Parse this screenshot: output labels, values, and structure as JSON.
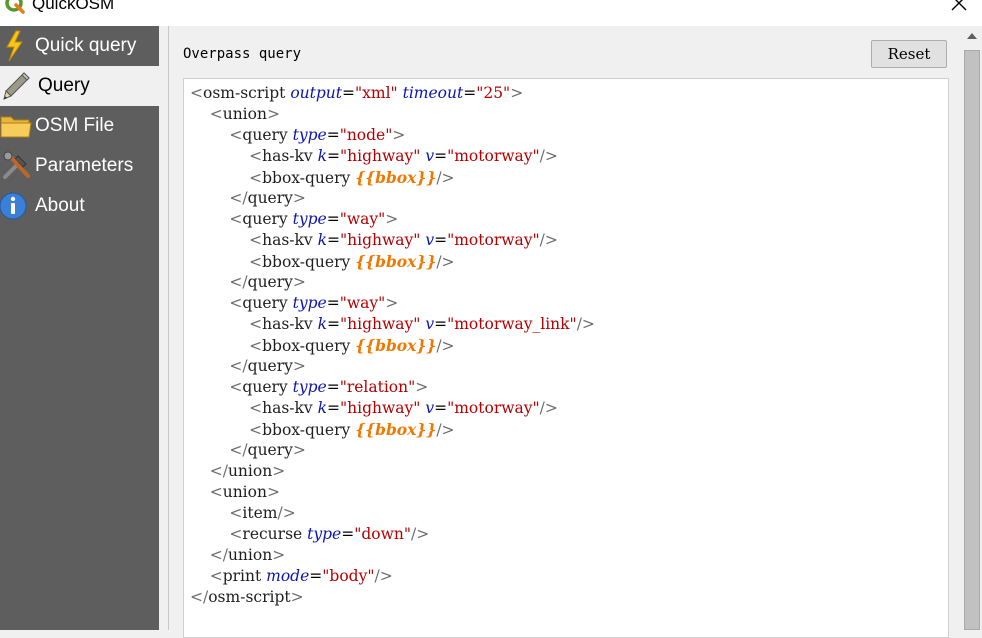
{
  "window": {
    "title": "QuickOSM"
  },
  "sidebar": {
    "items": [
      {
        "label": "Quick query",
        "icon": "lightning-icon",
        "active": false
      },
      {
        "label": "Query",
        "icon": "pencil-icon",
        "active": true
      },
      {
        "label": "OSM File",
        "icon": "folder-icon",
        "active": false
      },
      {
        "label": "Parameters",
        "icon": "tools-icon",
        "active": false
      },
      {
        "label": "About",
        "icon": "info-icon",
        "active": false
      }
    ]
  },
  "main": {
    "section_label": "Overpass query",
    "reset_label": "Reset",
    "query_lines": [
      [
        {
          "t": "br",
          "v": "<"
        },
        {
          "t": "tag",
          "v": "osm-script "
        },
        {
          "t": "attr",
          "v": "output"
        },
        {
          "t": "eq",
          "v": "="
        },
        {
          "t": "val",
          "v": "\"xml\""
        },
        {
          "t": "tag",
          "v": " "
        },
        {
          "t": "attr",
          "v": "timeout"
        },
        {
          "t": "eq",
          "v": "="
        },
        {
          "t": "val",
          "v": "\"25\""
        },
        {
          "t": "br",
          "v": ">"
        }
      ],
      [
        {
          "t": "tag",
          "v": "    "
        },
        {
          "t": "br",
          "v": "<"
        },
        {
          "t": "tag",
          "v": "union"
        },
        {
          "t": "br",
          "v": ">"
        }
      ],
      [
        {
          "t": "tag",
          "v": "        "
        },
        {
          "t": "br",
          "v": "<"
        },
        {
          "t": "tag",
          "v": "query "
        },
        {
          "t": "attr",
          "v": "type"
        },
        {
          "t": "eq",
          "v": "="
        },
        {
          "t": "val",
          "v": "\"node\""
        },
        {
          "t": "br",
          "v": ">"
        }
      ],
      [
        {
          "t": "tag",
          "v": "            "
        },
        {
          "t": "br",
          "v": "<"
        },
        {
          "t": "tag",
          "v": "has-kv "
        },
        {
          "t": "attr",
          "v": "k"
        },
        {
          "t": "eq",
          "v": "="
        },
        {
          "t": "val",
          "v": "\"highway\""
        },
        {
          "t": "tag",
          "v": " "
        },
        {
          "t": "attr",
          "v": "v"
        },
        {
          "t": "eq",
          "v": "="
        },
        {
          "t": "val",
          "v": "\"motorway\""
        },
        {
          "t": "br",
          "v": "/>"
        }
      ],
      [
        {
          "t": "tag",
          "v": "            "
        },
        {
          "t": "br",
          "v": "<"
        },
        {
          "t": "tag",
          "v": "bbox-query "
        },
        {
          "t": "tpl",
          "v": "{{bbox}}"
        },
        {
          "t": "br",
          "v": "/>"
        }
      ],
      [
        {
          "t": "tag",
          "v": "        "
        },
        {
          "t": "br",
          "v": "</"
        },
        {
          "t": "tag",
          "v": "query"
        },
        {
          "t": "br",
          "v": ">"
        }
      ],
      [
        {
          "t": "tag",
          "v": "        "
        },
        {
          "t": "br",
          "v": "<"
        },
        {
          "t": "tag",
          "v": "query "
        },
        {
          "t": "attr",
          "v": "type"
        },
        {
          "t": "eq",
          "v": "="
        },
        {
          "t": "val",
          "v": "\"way\""
        },
        {
          "t": "br",
          "v": ">"
        }
      ],
      [
        {
          "t": "tag",
          "v": "            "
        },
        {
          "t": "br",
          "v": "<"
        },
        {
          "t": "tag",
          "v": "has-kv "
        },
        {
          "t": "attr",
          "v": "k"
        },
        {
          "t": "eq",
          "v": "="
        },
        {
          "t": "val",
          "v": "\"highway\""
        },
        {
          "t": "tag",
          "v": " "
        },
        {
          "t": "attr",
          "v": "v"
        },
        {
          "t": "eq",
          "v": "="
        },
        {
          "t": "val",
          "v": "\"motorway\""
        },
        {
          "t": "br",
          "v": "/>"
        }
      ],
      [
        {
          "t": "tag",
          "v": "            "
        },
        {
          "t": "br",
          "v": "<"
        },
        {
          "t": "tag",
          "v": "bbox-query "
        },
        {
          "t": "tpl",
          "v": "{{bbox}}"
        },
        {
          "t": "br",
          "v": "/>"
        }
      ],
      [
        {
          "t": "tag",
          "v": "        "
        },
        {
          "t": "br",
          "v": "</"
        },
        {
          "t": "tag",
          "v": "query"
        },
        {
          "t": "br",
          "v": ">"
        }
      ],
      [
        {
          "t": "tag",
          "v": "        "
        },
        {
          "t": "br",
          "v": "<"
        },
        {
          "t": "tag",
          "v": "query "
        },
        {
          "t": "attr",
          "v": "type"
        },
        {
          "t": "eq",
          "v": "="
        },
        {
          "t": "val",
          "v": "\"way\""
        },
        {
          "t": "br",
          "v": ">"
        }
      ],
      [
        {
          "t": "tag",
          "v": "            "
        },
        {
          "t": "br",
          "v": "<"
        },
        {
          "t": "tag",
          "v": "has-kv "
        },
        {
          "t": "attr",
          "v": "k"
        },
        {
          "t": "eq",
          "v": "="
        },
        {
          "t": "val",
          "v": "\"highway\""
        },
        {
          "t": "tag",
          "v": " "
        },
        {
          "t": "attr",
          "v": "v"
        },
        {
          "t": "eq",
          "v": "="
        },
        {
          "t": "val",
          "v": "\"motorway_link\""
        },
        {
          "t": "br",
          "v": "/>"
        }
      ],
      [
        {
          "t": "tag",
          "v": "            "
        },
        {
          "t": "br",
          "v": "<"
        },
        {
          "t": "tag",
          "v": "bbox-query "
        },
        {
          "t": "tpl",
          "v": "{{bbox}}"
        },
        {
          "t": "br",
          "v": "/>"
        }
      ],
      [
        {
          "t": "tag",
          "v": "        "
        },
        {
          "t": "br",
          "v": "</"
        },
        {
          "t": "tag",
          "v": "query"
        },
        {
          "t": "br",
          "v": ">"
        }
      ],
      [
        {
          "t": "tag",
          "v": "        "
        },
        {
          "t": "br",
          "v": "<"
        },
        {
          "t": "tag",
          "v": "query "
        },
        {
          "t": "attr",
          "v": "type"
        },
        {
          "t": "eq",
          "v": "="
        },
        {
          "t": "val",
          "v": "\"relation\""
        },
        {
          "t": "br",
          "v": ">"
        }
      ],
      [
        {
          "t": "tag",
          "v": "            "
        },
        {
          "t": "br",
          "v": "<"
        },
        {
          "t": "tag",
          "v": "has-kv "
        },
        {
          "t": "attr",
          "v": "k"
        },
        {
          "t": "eq",
          "v": "="
        },
        {
          "t": "val",
          "v": "\"highway\""
        },
        {
          "t": "tag",
          "v": " "
        },
        {
          "t": "attr",
          "v": "v"
        },
        {
          "t": "eq",
          "v": "="
        },
        {
          "t": "val",
          "v": "\"motorway\""
        },
        {
          "t": "br",
          "v": "/>"
        }
      ],
      [
        {
          "t": "tag",
          "v": "            "
        },
        {
          "t": "br",
          "v": "<"
        },
        {
          "t": "tag",
          "v": "bbox-query "
        },
        {
          "t": "tpl",
          "v": "{{bbox}}"
        },
        {
          "t": "br",
          "v": "/>"
        }
      ],
      [
        {
          "t": "tag",
          "v": "        "
        },
        {
          "t": "br",
          "v": "</"
        },
        {
          "t": "tag",
          "v": "query"
        },
        {
          "t": "br",
          "v": ">"
        }
      ],
      [
        {
          "t": "tag",
          "v": "    "
        },
        {
          "t": "br",
          "v": "</"
        },
        {
          "t": "tag",
          "v": "union"
        },
        {
          "t": "br",
          "v": ">"
        }
      ],
      [
        {
          "t": "tag",
          "v": "    "
        },
        {
          "t": "br",
          "v": "<"
        },
        {
          "t": "tag",
          "v": "union"
        },
        {
          "t": "br",
          "v": ">"
        }
      ],
      [
        {
          "t": "tag",
          "v": "        "
        },
        {
          "t": "br",
          "v": "<"
        },
        {
          "t": "tag",
          "v": "item"
        },
        {
          "t": "br",
          "v": "/>"
        }
      ],
      [
        {
          "t": "tag",
          "v": "        "
        },
        {
          "t": "br",
          "v": "<"
        },
        {
          "t": "tag",
          "v": "recurse "
        },
        {
          "t": "attr",
          "v": "type"
        },
        {
          "t": "eq",
          "v": "="
        },
        {
          "t": "val",
          "v": "\"down\""
        },
        {
          "t": "br",
          "v": "/>"
        }
      ],
      [
        {
          "t": "tag",
          "v": "    "
        },
        {
          "t": "br",
          "v": "</"
        },
        {
          "t": "tag",
          "v": "union"
        },
        {
          "t": "br",
          "v": ">"
        }
      ],
      [
        {
          "t": "tag",
          "v": "    "
        },
        {
          "t": "br",
          "v": "<"
        },
        {
          "t": "tag",
          "v": "print "
        },
        {
          "t": "attr",
          "v": "mode"
        },
        {
          "t": "eq",
          "v": "="
        },
        {
          "t": "val",
          "v": "\"body\""
        },
        {
          "t": "br",
          "v": "/>"
        }
      ],
      [
        {
          "t": "br",
          "v": "</"
        },
        {
          "t": "tag",
          "v": "osm-script"
        },
        {
          "t": "br",
          "v": ">"
        }
      ]
    ]
  },
  "colors": {
    "sidebar_bg": "#5e5e5e",
    "attr": "#0c14b4",
    "value": "#b40000",
    "template": "#f07800"
  }
}
